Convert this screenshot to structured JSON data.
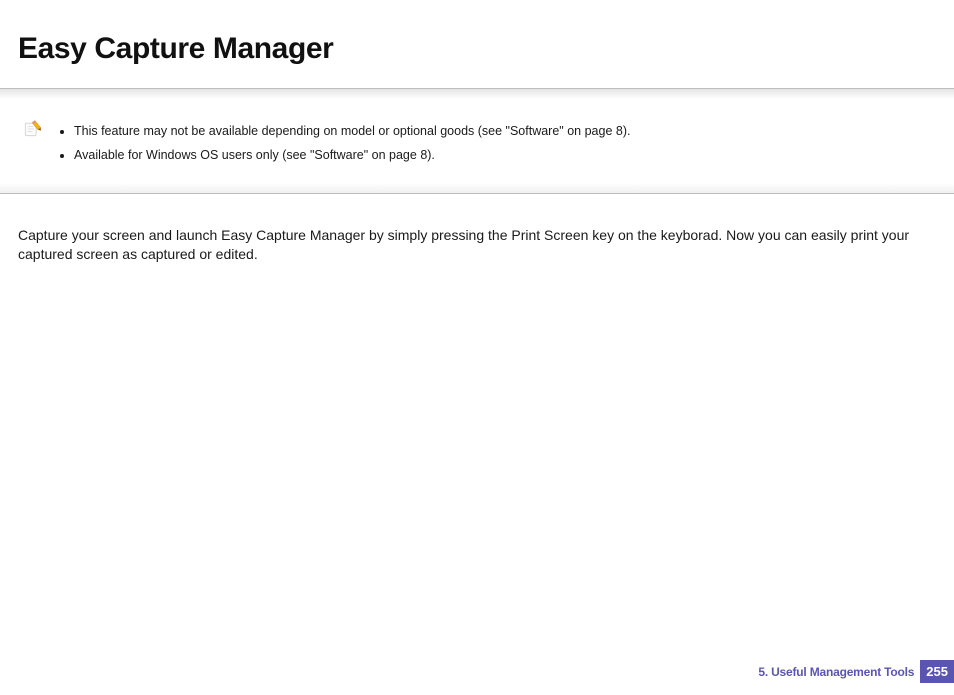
{
  "title": "Easy Capture Manager",
  "note": {
    "items": [
      "This feature may not be available depending on model or optional goods (see \"Software\" on page 8).",
      "Available for Windows OS users only (see \"Software\" on page 8)."
    ]
  },
  "body": "Capture your screen and launch Easy Capture Manager by simply pressing the Print Screen key on the keyborad. Now you can easily print your captured screen as captured or edited.",
  "footer": {
    "chapter": "5.  Useful Management Tools",
    "page": "255"
  }
}
